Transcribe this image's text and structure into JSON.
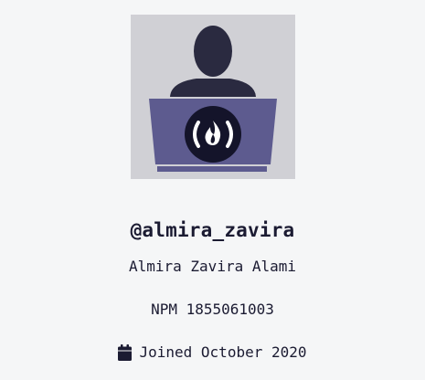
{
  "profile": {
    "username": "@almira_zavira",
    "full_name": "Almira Zavira Alami",
    "npm": "NPM 1855061003",
    "joined": "Joined October 2020"
  },
  "icons": {
    "avatar": "user-at-laptop-icon",
    "laptop_logo": "freecodecamp-flame-icon",
    "joined": "calendar-icon"
  },
  "colors": {
    "background": "#f5f6f7",
    "avatar_bg": "#d0d0d5",
    "figure": "#2a2a40",
    "laptop": "#5d5b8f",
    "laptop_dark": "#4d4b7c",
    "text": "#1b1b32"
  }
}
